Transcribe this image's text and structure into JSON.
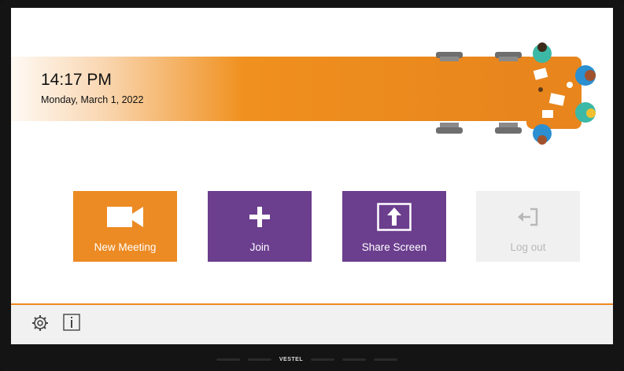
{
  "status": {
    "time": "14:17 PM",
    "date": "Monday, March 1, 2022"
  },
  "actions": {
    "new_meeting": "New Meeting",
    "join": "Join",
    "share_screen": "Share Screen",
    "log_out": "Log out"
  },
  "footer": {
    "settings_icon": "gear-icon",
    "info_icon": "info-icon"
  },
  "device": {
    "brand": "VESTEL"
  },
  "colors": {
    "accent_orange": "#ec8a23",
    "accent_purple": "#6b3e8e",
    "disabled_tile": "#f0f0f0"
  }
}
